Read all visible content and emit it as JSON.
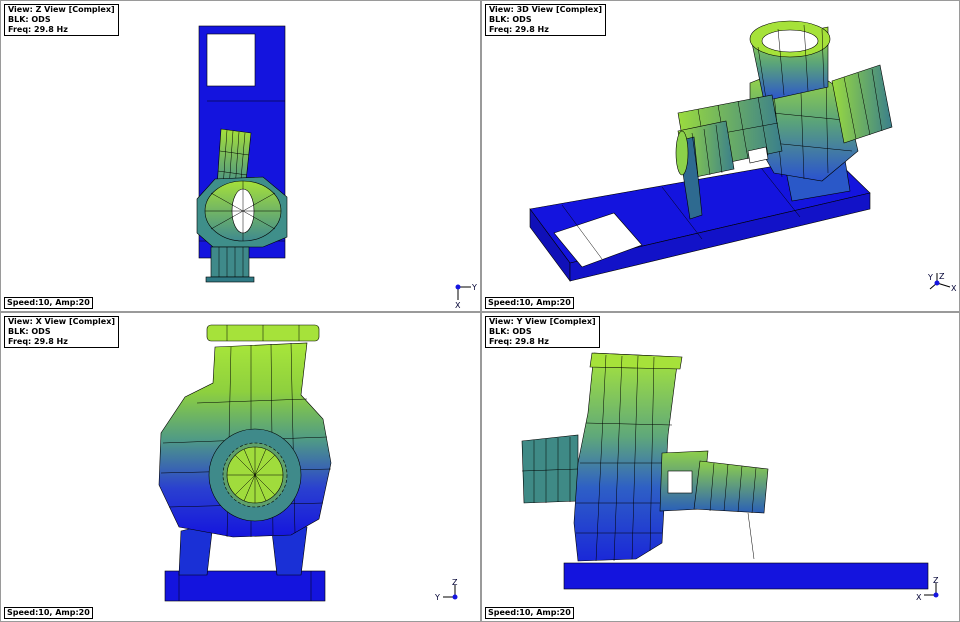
{
  "views": [
    {
      "name": "View: Z View [Complex]",
      "block": "BLK: ODS",
      "freq": "Freq: 29.8 Hz",
      "status": "Speed:10, Amp:20",
      "axis_labels": [
        "Y",
        "X"
      ]
    },
    {
      "name": "View: 3D View [Complex]",
      "block": "BLK: ODS",
      "freq": "Freq: 29.8 Hz",
      "status": "Speed:10, Amp:20",
      "axis_labels": [
        "Y",
        "Z",
        "X"
      ]
    },
    {
      "name": "View: X View [Complex]",
      "block": "BLK: ODS",
      "freq": "Freq: 29.8 Hz",
      "status": "Speed:10, Amp:20",
      "axis_labels": [
        "Z",
        "Y"
      ]
    },
    {
      "name": "View: Y View [Complex]",
      "block": "BLK: ODS",
      "freq": "Freq: 29.8 Hz",
      "status": "Speed:10, Amp:20",
      "axis_labels": [
        "Z",
        "X"
      ]
    }
  ],
  "colors": {
    "base_blue": "#1515e0",
    "mid_teal": "#3a8a8a",
    "high_green": "#a2e23c",
    "background": "#ffffff"
  }
}
